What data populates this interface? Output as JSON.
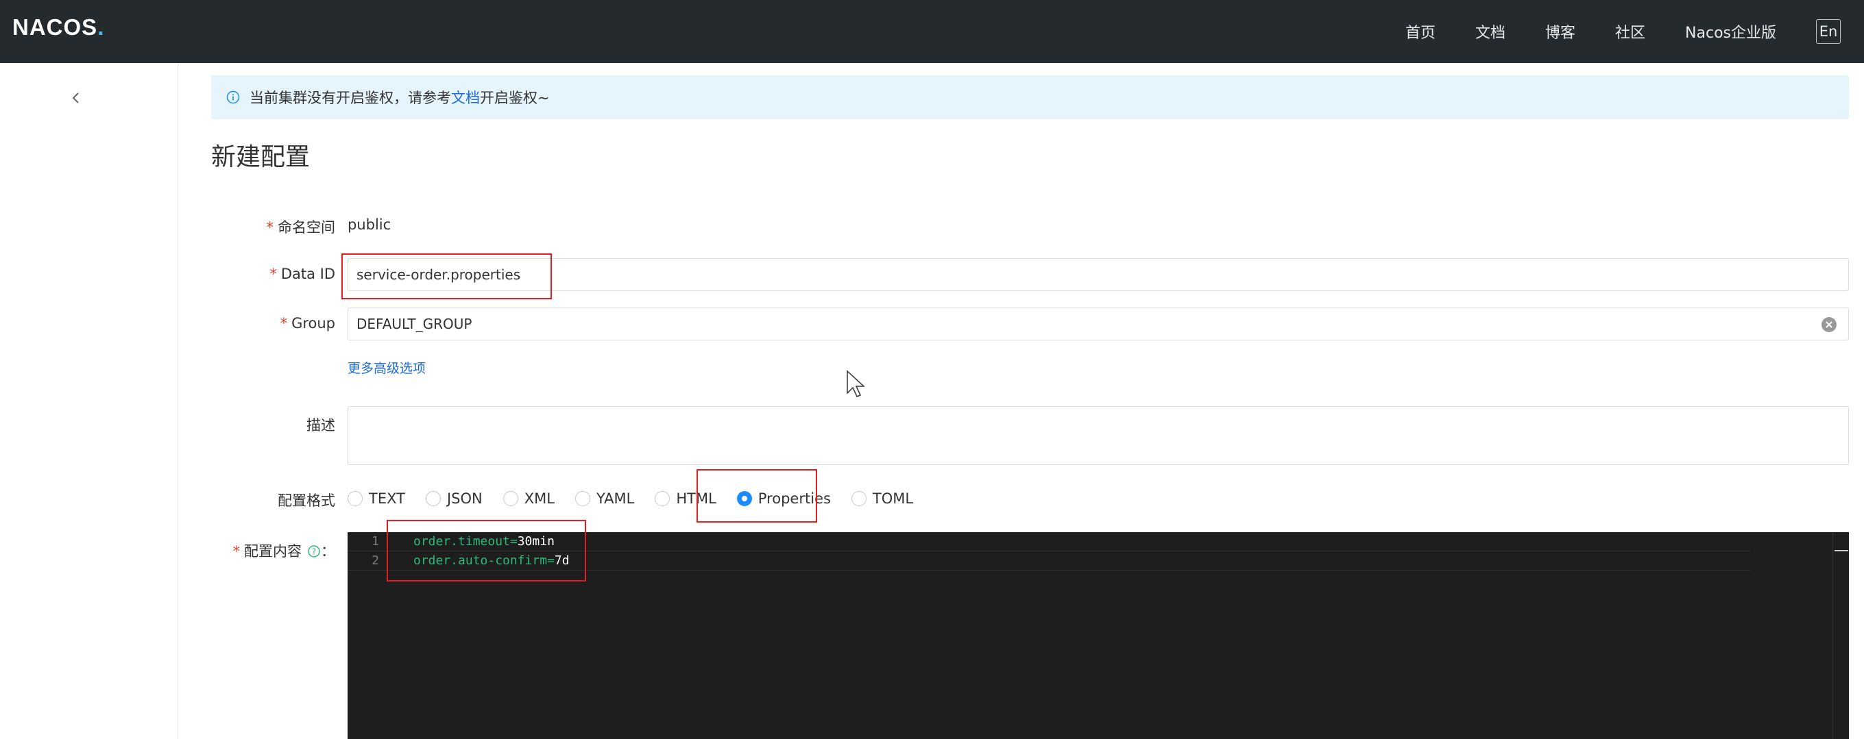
{
  "app": {
    "logo_main": "NACOS",
    "logo_dot": "."
  },
  "nav": {
    "items": [
      "首页",
      "文档",
      "博客",
      "社区",
      "Nacos企业版"
    ],
    "lang": "En"
  },
  "notice": {
    "prefix": "当前集群没有开启鉴权，请参考",
    "link": "文档",
    "suffix": "开启鉴权~"
  },
  "page": {
    "title": "新建配置"
  },
  "form": {
    "namespace": {
      "label": "命名空间",
      "value": "public"
    },
    "data_id": {
      "label": "Data ID",
      "value": "service-order.properties"
    },
    "group": {
      "label": "Group",
      "value": "DEFAULT_GROUP"
    },
    "more_options": "更多高级选项",
    "description": {
      "label": "描述",
      "value": ""
    },
    "format": {
      "label": "配置格式",
      "options": [
        "TEXT",
        "JSON",
        "XML",
        "YAML",
        "HTML",
        "Properties",
        "TOML"
      ],
      "selected": "Properties"
    },
    "content": {
      "label": "配置内容",
      "colon": "：",
      "lines": [
        {
          "num": "1",
          "key": "order.timeout=",
          "val": "30min"
        },
        {
          "num": "2",
          "key": "order.auto-confirm=",
          "val": "7d"
        }
      ]
    }
  },
  "colors": {
    "topbar": "#252a2f",
    "accent": "#1a8cff",
    "link": "#1d6bd8",
    "required": "#e0422f",
    "highlight": "#e02020",
    "editor_bg": "#1e1e1e",
    "code_key": "#2eb87a"
  }
}
